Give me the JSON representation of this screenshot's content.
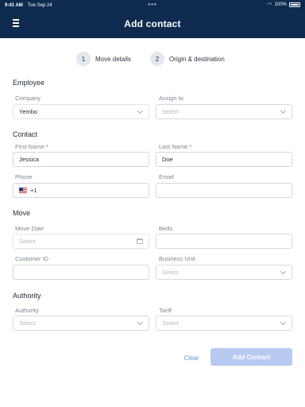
{
  "status_bar": {
    "time": "9:41 AM",
    "date": "Tue Sep 24",
    "battery": "100%"
  },
  "header": {
    "title": "Add contact"
  },
  "steps": [
    {
      "num": "1",
      "label": "Move details"
    },
    {
      "num": "2",
      "label": "Origin & destination"
    }
  ],
  "employee": {
    "title": "Employee",
    "company_label": "Company",
    "company_value": "Yembo",
    "assign_label": "Assign to",
    "assign_placeholder": "Select"
  },
  "contact": {
    "title": "Contact",
    "first_name_label": "First Name *",
    "first_name_value": "Jessica",
    "last_name_label": "Last Name *",
    "last_name_value": "Doe",
    "phone_label": "Phone",
    "phone_code": "+1",
    "email_label": "Email",
    "email_value": ""
  },
  "move": {
    "title": "Move",
    "move_date_label": "Move Date",
    "move_date_placeholder": "Select",
    "beds_label": "Beds",
    "beds_value": "",
    "customer_id_label": "Customer ID",
    "customer_id_value": "",
    "business_unit_label": "Business Unit",
    "business_unit_placeholder": "Select"
  },
  "authority": {
    "title": "Authority",
    "authority_label": "Authority",
    "authority_placeholder": "Select",
    "tariff_label": "Tariff",
    "tariff_placeholder": "Select"
  },
  "actions": {
    "clear": "Clear",
    "add": "Add Contact"
  },
  "colors": {
    "header_bg": "#0f2a4f",
    "accent": "#6c8fe0",
    "button_disabled": "#b8c9f2"
  }
}
